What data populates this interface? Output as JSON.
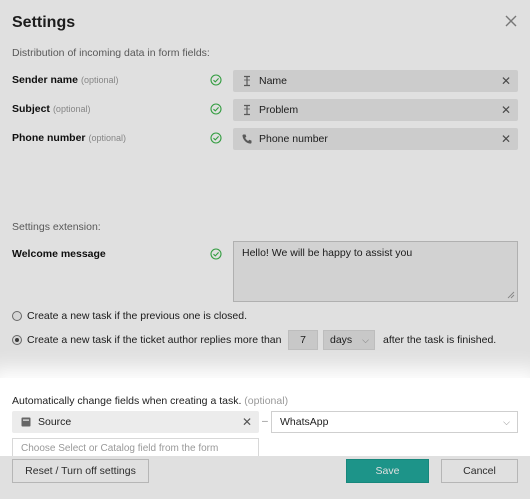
{
  "dialog": {
    "title": "Settings"
  },
  "distribution": {
    "label": "Distribution of incoming data in form fields:",
    "rows": [
      {
        "label": "Sender name",
        "optional": "(optional)",
        "value": "Name",
        "icon": "text-cursor-icon"
      },
      {
        "label": "Subject",
        "optional": "(optional)",
        "value": "Problem",
        "icon": "text-cursor-icon"
      },
      {
        "label": "Phone number",
        "optional": "(optional)",
        "value": "Phone number",
        "icon": "phone-icon"
      }
    ]
  },
  "extension": {
    "label": "Settings extension:",
    "welcome_label": "Welcome message",
    "welcome_value": "Hello! We will be happy to assist you"
  },
  "options": {
    "radio1": "Create a new task if the previous one is closed.",
    "radio2": "Create a new task if the ticket author replies more than",
    "days_value": "7",
    "days_unit": "days",
    "after_text": "after the task is finished."
  },
  "auto_change": {
    "label": "Automatically change fields when creating a task.",
    "optional": "(optional)",
    "source_field": "Source",
    "separator": "–",
    "source_value": "WhatsApp",
    "choose_placeholder": "Choose Select or Catalog field from the form"
  },
  "footer": {
    "reset_label": "Reset / Turn off settings",
    "save_label": "Save",
    "cancel_label": "Cancel"
  },
  "colors": {
    "accent": "#21a99d",
    "check": "#3bb34a"
  }
}
